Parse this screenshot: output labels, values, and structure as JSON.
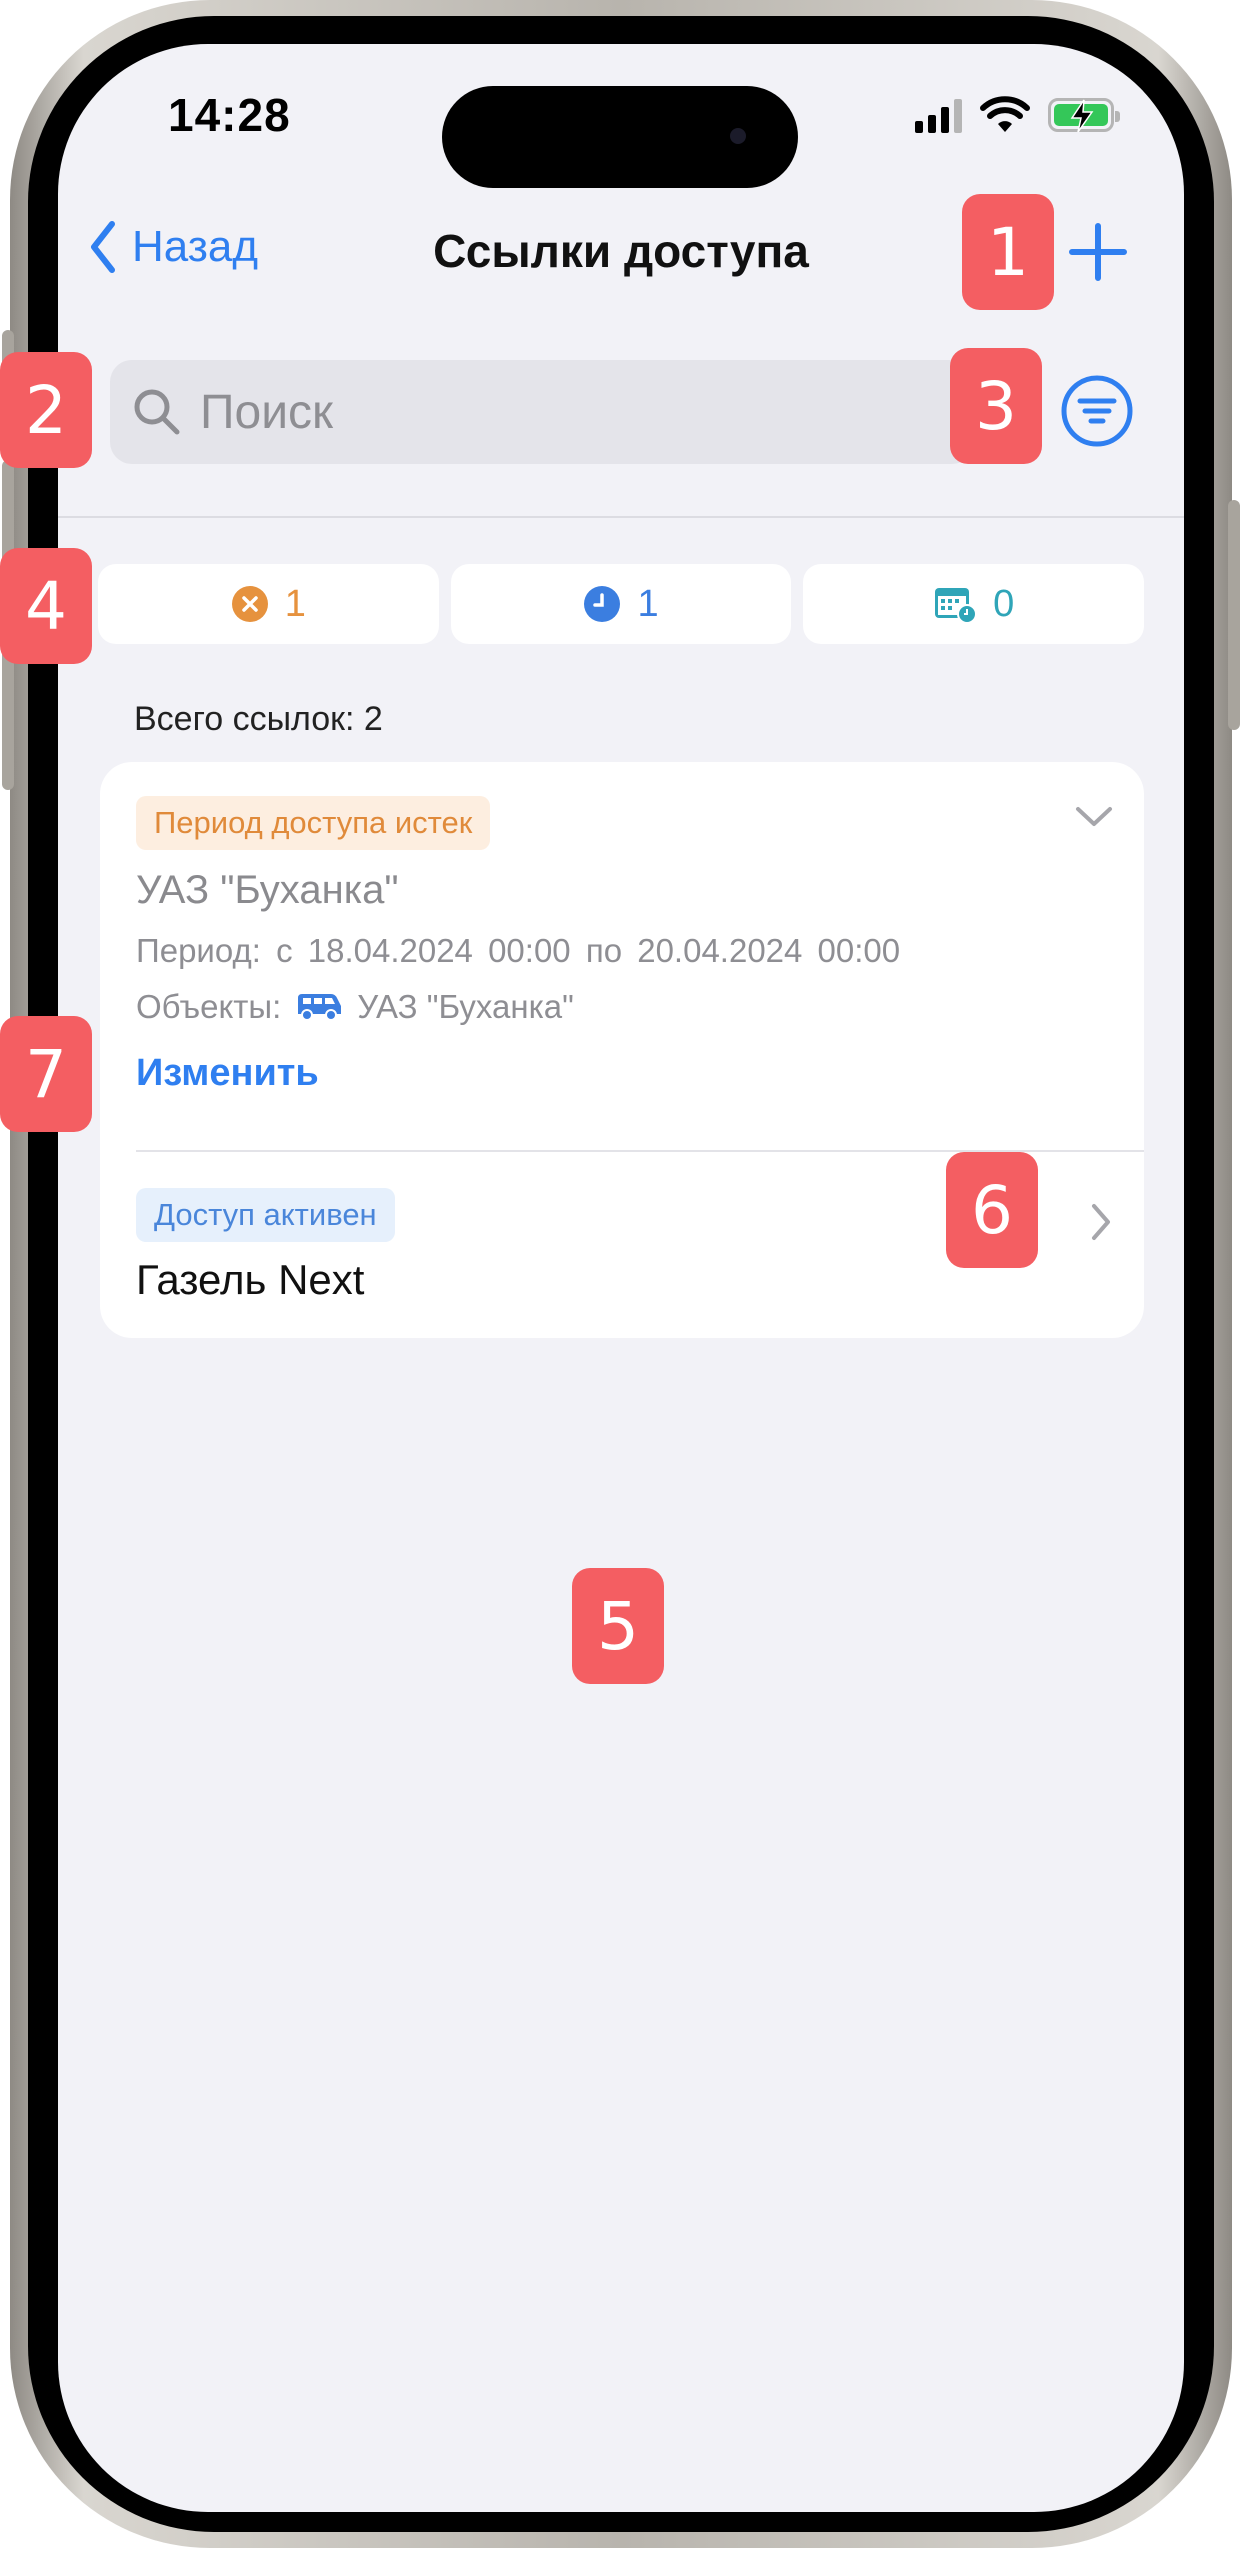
{
  "status_bar": {
    "time": "14:28"
  },
  "nav": {
    "back_label": "Назад",
    "title": "Ссылки доступа",
    "add_icon": "plus-icon"
  },
  "search": {
    "placeholder": "Поиск",
    "value": "",
    "filter_icon": "filter-icon"
  },
  "counters": [
    {
      "icon": "expired-icon",
      "count": "1",
      "color": "#e6923e"
    },
    {
      "icon": "clock-icon",
      "count": "1",
      "color": "#3b7ee0"
    },
    {
      "icon": "calendar-icon",
      "count": "0",
      "color": "#2fa5b8"
    }
  ],
  "summary": {
    "total": "Всего ссылок: 2"
  },
  "links": [
    {
      "badge": "Период доступа истек",
      "title": "УАЗ \"Буханка\"",
      "period": "Период:  с  18.04.2024 00:00  по  20.04.2024 00:00",
      "objects_label": "Объекты:",
      "object_name": "УАЗ \"Буханка\"",
      "action": "Изменить"
    },
    {
      "badge": "Доступ активен",
      "title": "Газель Next"
    }
  ],
  "colors": {
    "accent": "#2f7ff0",
    "background": "#f2f2f7",
    "expired_badge_bg": "#fdeee0",
    "expired_badge_text": "#e08a3a",
    "active_badge_bg": "#e6f0fc",
    "active_badge_text": "#4a86da",
    "marker": "#f45e62"
  },
  "markers": [
    "1",
    "2",
    "3",
    "4",
    "5",
    "6",
    "7"
  ]
}
